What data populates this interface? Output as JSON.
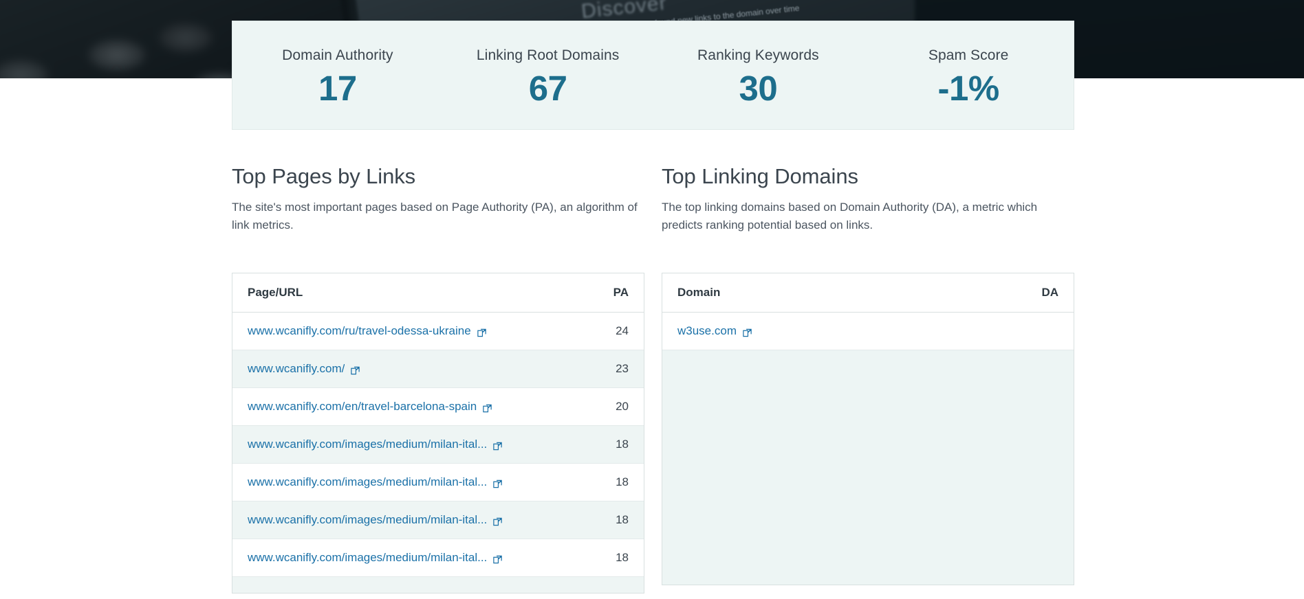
{
  "stats": {
    "items": [
      {
        "label": "Domain Authority",
        "value": "17"
      },
      {
        "label": "Linking Root Domains",
        "value": "67"
      },
      {
        "label": "Ranking Keywords",
        "value": "30"
      },
      {
        "label": "Spam Score",
        "value": "-1%"
      }
    ]
  },
  "top_pages": {
    "title": "Top Pages by Links",
    "description": "The site's most important pages based on Page Authority (PA), an algorithm of link metrics.",
    "columns": {
      "page": "Page/URL",
      "score": "PA"
    },
    "rows": [
      {
        "url": "www.wcanifly.com/ru/travel-odessa-ukraine",
        "pa": "24"
      },
      {
        "url": "www.wcanifly.com/",
        "pa": "23"
      },
      {
        "url": "www.wcanifly.com/en/travel-barcelona-spain",
        "pa": "20"
      },
      {
        "url": "www.wcanifly.com/images/medium/milan-ital...",
        "pa": "18"
      },
      {
        "url": "www.wcanifly.com/images/medium/milan-ital...",
        "pa": "18"
      },
      {
        "url": "www.wcanifly.com/images/medium/milan-ital...",
        "pa": "18"
      },
      {
        "url": "www.wcanifly.com/images/medium/milan-ital...",
        "pa": "18"
      }
    ]
  },
  "top_domains": {
    "title": "Top Linking Domains",
    "description": "The top linking domains based on Domain Authority (DA), a metric which predicts ranking potential based on links.",
    "columns": {
      "domain": "Domain",
      "score": "DA"
    },
    "rows": [
      {
        "domain": "w3use.com",
        "da": ""
      }
    ]
  },
  "icons": {
    "external_link": "external-link-icon"
  },
  "colors": {
    "card_bg": "#edf5f4",
    "accent": "#1d6e8c",
    "link": "#1b71a8",
    "text": "#3b454e",
    "border": "#d8e0e0",
    "banner": "#0d161b"
  }
}
